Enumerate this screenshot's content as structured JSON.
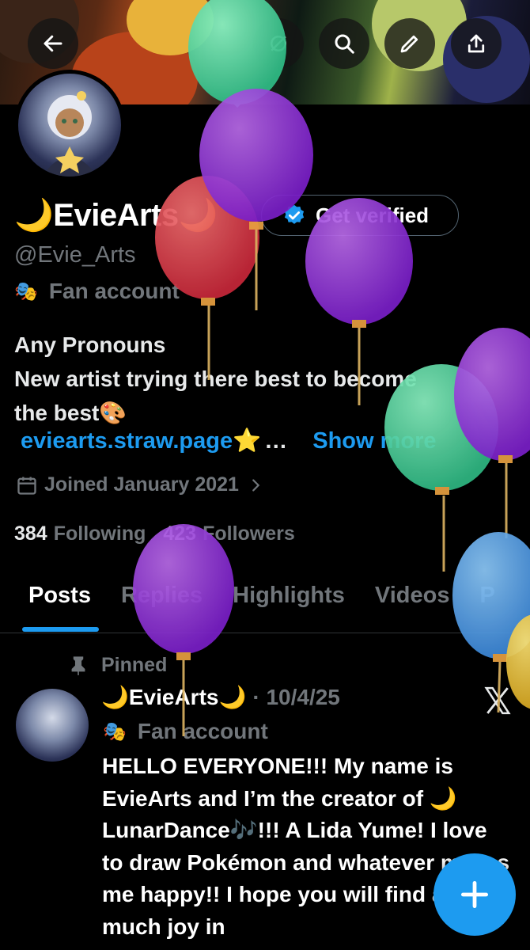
{
  "header": {
    "back_icon": "arrow-left-icon",
    "icons": [
      "grok-icon",
      "search-icon",
      "edit-icon",
      "share-icon"
    ]
  },
  "profile": {
    "display_name": "🌙EvieArts🌙",
    "verify_button": "Get verified",
    "handle": "@Evie_Arts",
    "account_type": "Fan account",
    "bio_line1": "Any Pronouns",
    "bio_line2": "New artist trying there best to become",
    "bio_line3": "the best🎨",
    "link": "eviearts.straw.page⭐",
    "ellipsis": "…",
    "show_more": "Show more",
    "joined": "Joined January 2021",
    "following_count": "384",
    "following_label": "Following",
    "followers_count": "423",
    "followers_label": "Followers"
  },
  "tabs": [
    {
      "label": "Posts",
      "active": true
    },
    {
      "label": "Replies",
      "active": false
    },
    {
      "label": "Highlights",
      "active": false
    },
    {
      "label": "Videos",
      "active": false
    },
    {
      "label": "P",
      "active": false
    }
  ],
  "pinned_post": {
    "pinned_label": "Pinned",
    "author": "🌙EvieArts🌙",
    "date": "· 10/4/25",
    "account_type": "Fan account",
    "text": "HELLO EVERYONE!!! My name is EvieArts and I’m the creator of 🌙 LunarDance🎶!!! A Lida Yume! I love to draw Pokémon and whatever makes me happy!! I hope you will find as much joy in"
  },
  "colors": {
    "accent": "#1d9bf0",
    "muted": "#71767b",
    "background": "#000000"
  }
}
